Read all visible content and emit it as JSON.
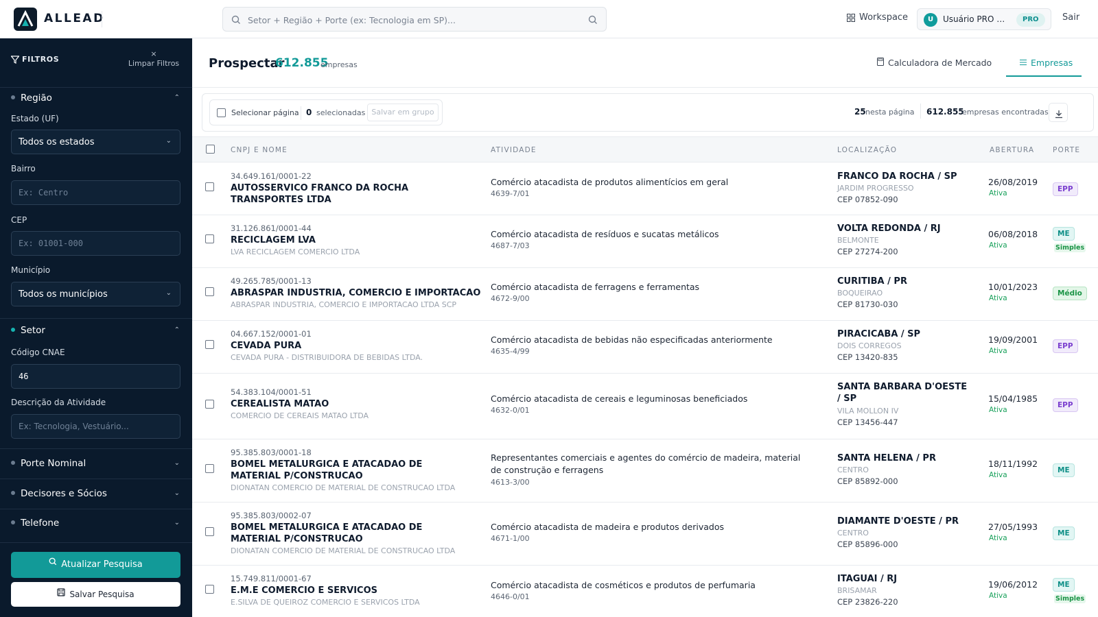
{
  "header": {
    "brand": "ALLEAD",
    "search_placeholder": "Setor + Região + Porte (ex: Tecnologia em SP)...",
    "workspace_label": "Workspace",
    "user_initial": "U",
    "user_name": "Usuário PRO De...",
    "user_badge": "PRO",
    "logout_label": "Sair"
  },
  "sidebar": {
    "filters_title": "FILTROS",
    "clear_label": "Limpar Filtros",
    "region": {
      "title": "Região",
      "state_label": "Estado (UF)",
      "state_value": "Todos os estados",
      "bairro_label": "Bairro",
      "bairro_placeholder": "Ex: Centro",
      "cep_label": "CEP",
      "cep_placeholder": "Ex: 01001-000",
      "municipio_label": "Município",
      "municipio_value": "Todos os municípios"
    },
    "sector": {
      "title": "Setor",
      "cnae_label": "Código CNAE",
      "cnae_value": "46",
      "desc_label": "Descrição da Atividade",
      "desc_placeholder": "Ex: Tecnologia, Vestuário..."
    },
    "collapsed_sections": [
      "Porte Nominal",
      "Decisores e Sócios",
      "Telefone"
    ],
    "update_button": "Atualizar Pesquisa",
    "save_button": "Salvar Pesquisa"
  },
  "main": {
    "title": "Prospectar",
    "count": "612.855",
    "count_unit": "empresas",
    "tabs": [
      "Calculadora de Mercado",
      "Empresas"
    ],
    "active_tab": "Empresas",
    "toolbar": {
      "select_page": "Selecionar página",
      "selected_count": "0",
      "selected_label": "selecionadas",
      "save_group": "Salvar em grupo",
      "page_count": "25",
      "page_label": "nesta página",
      "found_count": "612.855",
      "found_label": "empresas encontradas"
    },
    "columns": [
      "CNPJ E NOME",
      "ATIVIDADE",
      "LOCALIZAÇÃO",
      "ABERTURA",
      "PORTE"
    ],
    "rows": [
      {
        "cnpj": "34.649.161/0001-22",
        "name": "AUTOSSERVICO FRANCO DA ROCHA TRANSPORTES LTDA",
        "trade": "",
        "activity": "Comércio atacadista de produtos alimentícios em geral",
        "code": "4639-7/01",
        "city": "FRANCO DA ROCHA / SP",
        "bairro": "JARDIM PROGRESSO",
        "cep": "CEP 07852-090",
        "date": "26/08/2019",
        "status": "Ativa",
        "porte": "EPP",
        "simples": ""
      },
      {
        "cnpj": "31.126.861/0001-44",
        "name": "RECICLAGEM LVA",
        "trade": "LVA RECICLAGEM COMERCIO LTDA",
        "activity": "Comércio atacadista de resíduos e sucatas metálicos",
        "code": "4687-7/03",
        "city": "VOLTA REDONDA / RJ",
        "bairro": "BELMONTE",
        "cep": "CEP 27274-200",
        "date": "06/08/2018",
        "status": "Ativa",
        "porte": "ME",
        "simples": "Simples"
      },
      {
        "cnpj": "49.265.785/0001-13",
        "name": "ABRASPAR INDUSTRIA, COMERCIO E IMPORTACAO",
        "trade": "ABRASPAR INDUSTRIA, COMERCIO E IMPORTACAO LTDA SCP",
        "activity": "Comércio atacadista de ferragens e ferramentas",
        "code": "4672-9/00",
        "city": "CURITIBA / PR",
        "bairro": "BOQUEIRAO",
        "cep": "CEP 81730-030",
        "date": "10/01/2023",
        "status": "Ativa",
        "porte": "Médio",
        "simples": ""
      },
      {
        "cnpj": "04.667.152/0001-01",
        "name": "CEVADA PURA",
        "trade": "CEVADA PURA - DISTRIBUIDORA DE BEBIDAS LTDA.",
        "activity": "Comércio atacadista de bebidas não especificadas anteriormente",
        "code": "4635-4/99",
        "city": "PIRACICABA / SP",
        "bairro": "DOIS CORREGOS",
        "cep": "CEP 13420-835",
        "date": "19/09/2001",
        "status": "Ativa",
        "porte": "EPP",
        "simples": ""
      },
      {
        "cnpj": "54.383.104/0001-51",
        "name": "CEREALISTA MATAO",
        "trade": "COMERCIO DE CEREAIS MATAO LTDA",
        "activity": "Comércio atacadista de cereais e leguminosas beneficiados",
        "code": "4632-0/01",
        "city": "SANTA BARBARA D'OESTE / SP",
        "bairro": "VILA MOLLON IV",
        "cep": "CEP 13456-447",
        "date": "15/04/1985",
        "status": "Ativa",
        "porte": "EPP",
        "simples": ""
      },
      {
        "cnpj": "95.385.803/0001-18",
        "name": "BOMEL METALURGICA E ATACADAO DE MATERIAL P/CONSTRUCAO",
        "trade": "DIONATAN COMERCIO DE MATERIAL DE CONSTRUCAO LTDA",
        "activity": "Representantes comerciais e agentes do comércio de madeira, material de construção e ferragens",
        "code": "4613-3/00",
        "city": "SANTA HELENA / PR",
        "bairro": "CENTRO",
        "cep": "CEP 85892-000",
        "date": "18/11/1992",
        "status": "Ativa",
        "porte": "ME",
        "simples": ""
      },
      {
        "cnpj": "95.385.803/0002-07",
        "name": "BOMEL METALURGICA E ATACADAO DE MATERIAL P/CONSTRUCAO",
        "trade": "DIONATAN COMERCIO DE MATERIAL DE CONSTRUCAO LTDA",
        "activity": "Comércio atacadista de madeira e produtos derivados",
        "code": "4671-1/00",
        "city": "DIAMANTE D'OESTE / PR",
        "bairro": "CENTRO",
        "cep": "CEP 85896-000",
        "date": "27/05/1993",
        "status": "Ativa",
        "porte": "ME",
        "simples": ""
      },
      {
        "cnpj": "15.749.811/0001-67",
        "name": "E.M.E COMERCIO E SERVICOS",
        "trade": "E.SILVA DE QUEIROZ COMERCIO E SERVICOS LTDA",
        "activity": "Comércio atacadista de cosméticos e produtos de perfumaria",
        "code": "4646-0/01",
        "city": "ITAGUAI / RJ",
        "bairro": "BRISAMAR",
        "cep": "CEP 23826-220",
        "date": "19/06/2012",
        "status": "Ativa",
        "porte": "ME",
        "simples": "Simples"
      }
    ]
  }
}
